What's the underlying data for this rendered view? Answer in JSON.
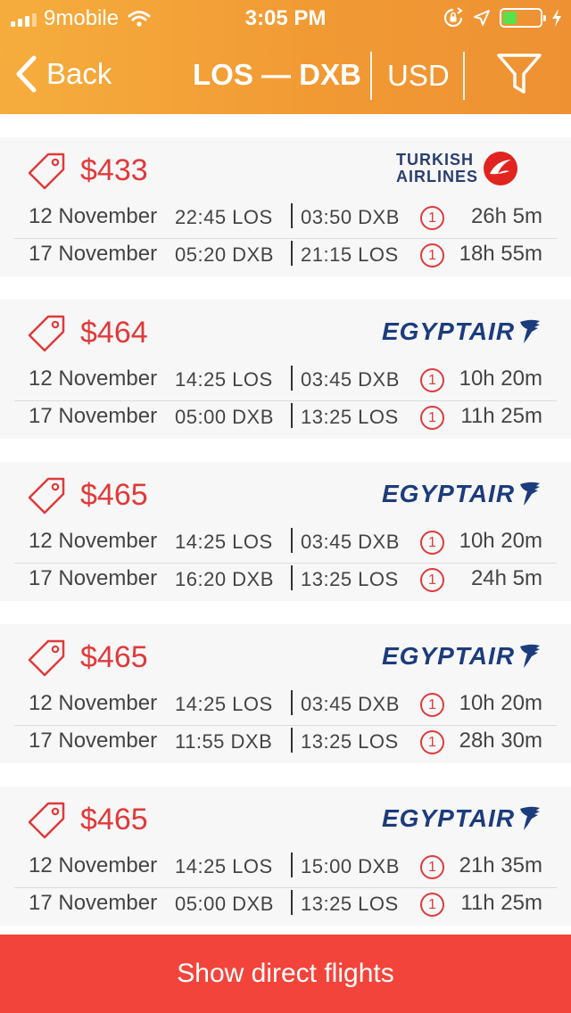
{
  "status_bar": {
    "carrier": "9mobile",
    "time": "3:05 PM",
    "battery_level": 0.3
  },
  "nav": {
    "back_label": "Back",
    "route": "LOS — DXB",
    "currency": "USD"
  },
  "flights": [
    {
      "price": "$433",
      "airline": "Turkish Airlines",
      "logo_lines": [
        "TURKISH",
        "AIRLINES"
      ],
      "segments": [
        {
          "date": "12 November",
          "dep": "22:45 LOS",
          "arr": "03:50 DXB",
          "stops": "1",
          "duration": "26h 5m"
        },
        {
          "date": "17 November",
          "dep": "05:20 DXB",
          "arr": "21:15 LOS",
          "stops": "1",
          "duration": "18h 55m"
        }
      ]
    },
    {
      "price": "$464",
      "airline": "EgyptAir",
      "logo_text": "EGYPTAIR",
      "segments": [
        {
          "date": "12 November",
          "dep": "14:25 LOS",
          "arr": "03:45 DXB",
          "stops": "1",
          "duration": "10h 20m"
        },
        {
          "date": "17 November",
          "dep": "05:00 DXB",
          "arr": "13:25 LOS",
          "stops": "1",
          "duration": "11h 25m"
        }
      ]
    },
    {
      "price": "$465",
      "airline": "EgyptAir",
      "logo_text": "EGYPTAIR",
      "segments": [
        {
          "date": "12 November",
          "dep": "14:25 LOS",
          "arr": "03:45 DXB",
          "stops": "1",
          "duration": "10h 20m"
        },
        {
          "date": "17 November",
          "dep": "16:20 DXB",
          "arr": "13:25 LOS",
          "stops": "1",
          "duration": "24h 5m"
        }
      ]
    },
    {
      "price": "$465",
      "airline": "EgyptAir",
      "logo_text": "EGYPTAIR",
      "segments": [
        {
          "date": "12 November",
          "dep": "14:25 LOS",
          "arr": "03:45 DXB",
          "stops": "1",
          "duration": "10h 20m"
        },
        {
          "date": "17 November",
          "dep": "11:55 DXB",
          "arr": "13:25 LOS",
          "stops": "1",
          "duration": "28h 30m"
        }
      ]
    },
    {
      "price": "$465",
      "airline": "EgyptAir",
      "logo_text": "EGYPTAIR",
      "segments": [
        {
          "date": "12 November",
          "dep": "14:25 LOS",
          "arr": "15:00 DXB",
          "stops": "1",
          "duration": "21h 35m"
        },
        {
          "date": "17 November",
          "dep": "05:00 DXB",
          "arr": "13:25 LOS",
          "stops": "1",
          "duration": "11h 25m"
        }
      ]
    }
  ],
  "cta_label": "Show direct flights",
  "colors": {
    "header_gradient_start": "#f6ad3d",
    "header_gradient_end": "#ee9133",
    "price_red": "#e03a3a",
    "cta_red": "#f2443b",
    "card_bg": "#f7f7f8"
  },
  "icons": [
    "cellular-signal-icon",
    "wifi-icon",
    "orientation-lock-icon",
    "location-arrow-icon",
    "battery-icon",
    "charging-bolt-icon",
    "back-chevron-icon",
    "filter-funnel-icon",
    "price-tag-icon",
    "turkish-airlines-logo",
    "egyptair-logo"
  ]
}
